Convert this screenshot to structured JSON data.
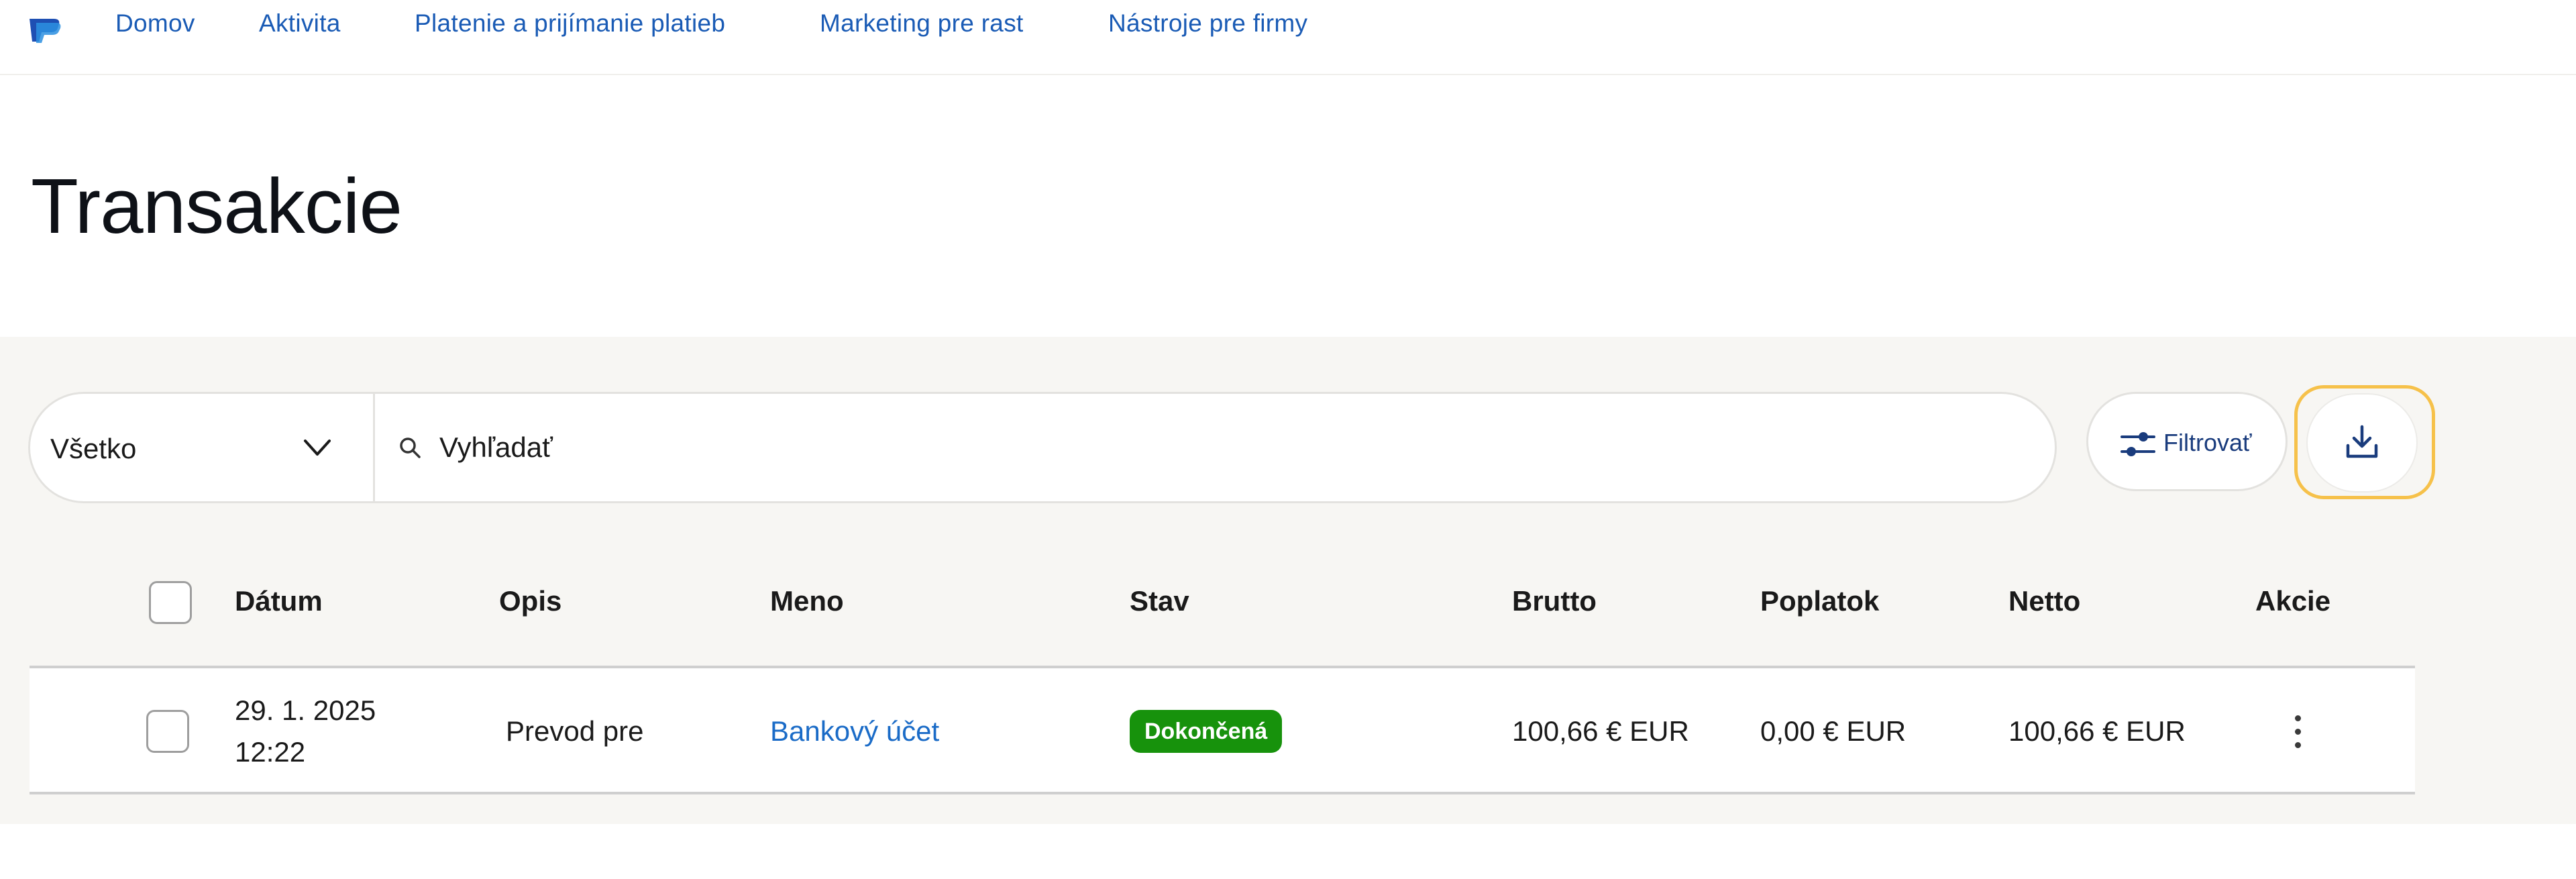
{
  "nav": {
    "items": [
      {
        "label": "Domov"
      },
      {
        "label": "Aktivita"
      },
      {
        "label": "Platenie a prijímanie platieb"
      },
      {
        "label": "Marketing pre rast"
      },
      {
        "label": "Nástroje pre firmy"
      }
    ]
  },
  "page": {
    "title": "Transakcie"
  },
  "filters": {
    "type_select_value": "Všetko",
    "search_placeholder": "Vyhľadať",
    "filter_button_label": "Filtrovať",
    "download_icon": "download-icon"
  },
  "table": {
    "columns": [
      "Dátum",
      "Opis",
      "Meno",
      "Stav",
      "Brutto",
      "Poplatok",
      "Netto",
      "Akcie"
    ],
    "rows": [
      {
        "date_line1": "29. 1. 2025",
        "date_line2": "12:22",
        "description": "Prevod pre",
        "name": "Bankový účet",
        "status": "Dokončená",
        "gross": "100,66 € EUR",
        "fee": "0,00 € EUR",
        "net": "100,66 € EUR"
      }
    ]
  },
  "colors": {
    "link": "#1a6bc7",
    "nav_text": "#1a5bb5",
    "status_complete": "#17920c",
    "focus_ring": "#f6c14a",
    "panel_bg": "#f7f6f3"
  }
}
